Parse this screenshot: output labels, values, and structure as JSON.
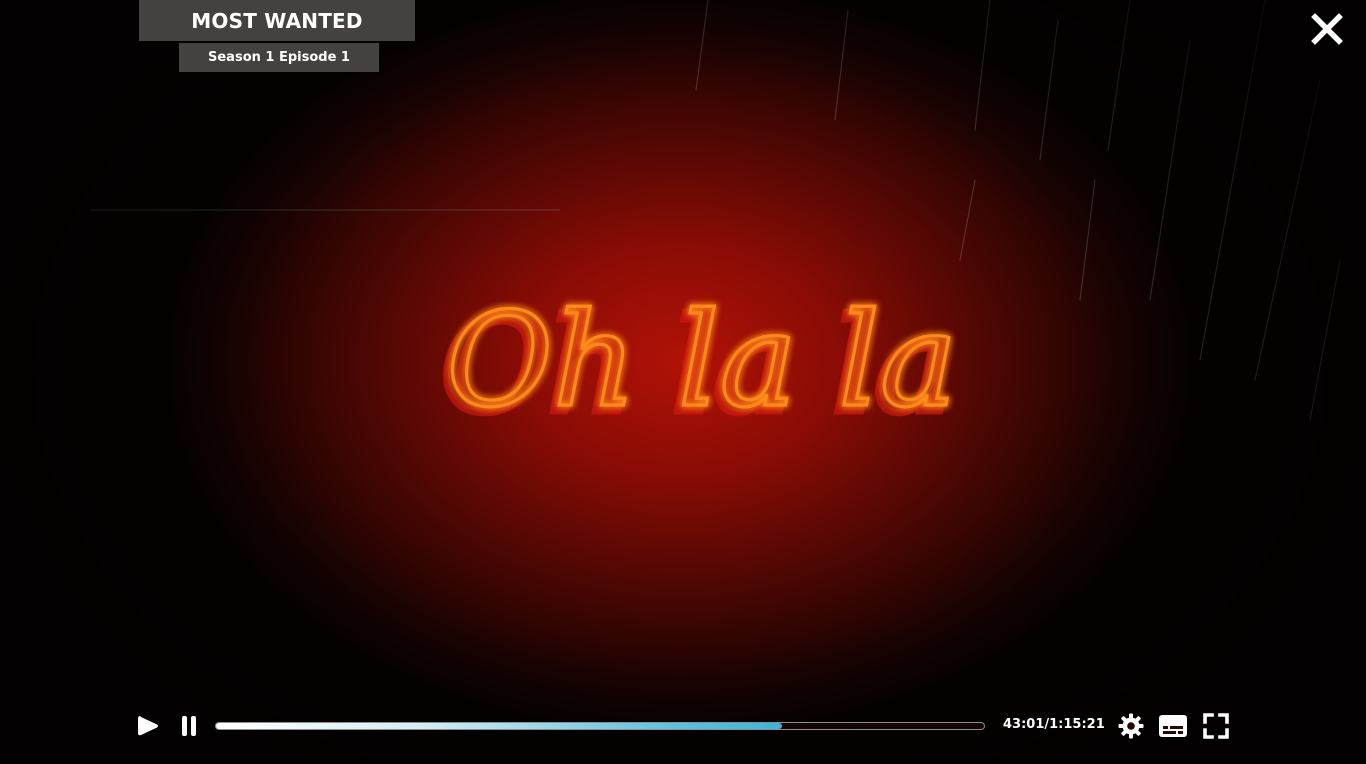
{
  "video": {
    "scene_text": "Oh la la",
    "progress_fraction": 0.737
  },
  "header": {
    "show_title": "MOST WANTED",
    "episode_label": "Season 1 Episode 1"
  },
  "controls": {
    "time_display": "43:01/1:15:21",
    "icons": [
      "play-icon",
      "pause-icon",
      "gear-icon",
      "subtitles-icon",
      "fullscreen-icon",
      "close-icon"
    ]
  },
  "colors": {
    "progress_accent": "#3ab4dc",
    "neon": "#ff8a1e",
    "background": "#8a0c05"
  }
}
